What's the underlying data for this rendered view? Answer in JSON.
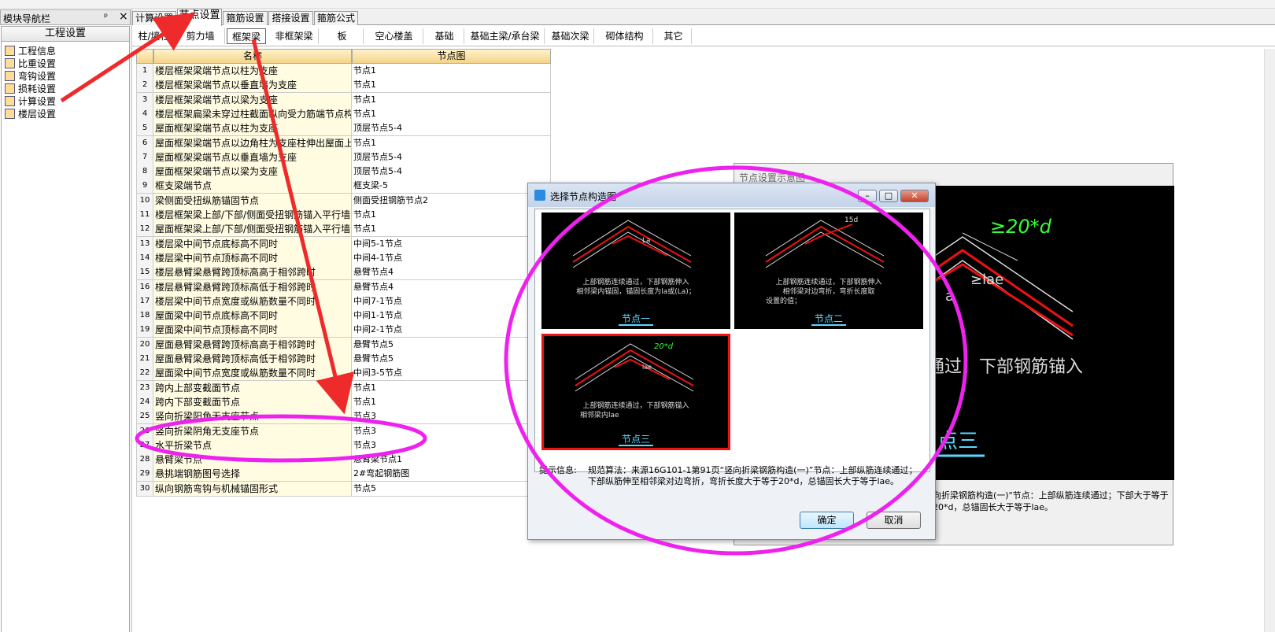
{
  "nav": {
    "title": "模块导航栏",
    "pin": "ᵖ",
    "close": "×",
    "group": "工程设置",
    "items": [
      {
        "label": "工程信息"
      },
      {
        "label": "比重设置"
      },
      {
        "label": "弯钩设置"
      },
      {
        "label": "损耗设置"
      },
      {
        "label": "计算设置"
      },
      {
        "label": "楼层设置"
      }
    ]
  },
  "tabs": [
    "计算设置",
    "节点设置",
    "箍筋设置",
    "搭接设置",
    "箍筋公式"
  ],
  "subtabs": [
    "柱/墙柱",
    "剪力墙",
    "框架梁",
    "非框架梁",
    "板",
    "空心楼盖",
    "基础",
    "基础主梁/承台梁",
    "基础次梁",
    "砌体结构",
    "其它"
  ],
  "table": {
    "headers": [
      "名称",
      "节点图"
    ],
    "rows": [
      {
        "no": "1",
        "name": "楼层框架梁端节点以柱为支座",
        "node": "节点1"
      },
      {
        "no": "2",
        "name": "楼层框架梁端节点以垂直墙为支座",
        "node": "节点1"
      },
      {
        "no": "3",
        "name": "楼层框架梁端节点以梁为支座",
        "node": "节点1"
      },
      {
        "no": "4",
        "name": "楼层框架扁梁未穿过柱截面纵向受力筋端节点构",
        "node": "节点1"
      },
      {
        "no": "5",
        "name": "屋面框架梁端节点以柱为支座",
        "node": "顶层节点5-4"
      },
      {
        "no": "6",
        "name": "屋面框架梁端节点以边角柱为支座柱伸出屋面上",
        "node": "节点1"
      },
      {
        "no": "7",
        "name": "屋面框架梁端节点以垂直墙为支座",
        "node": "顶层节点5-4"
      },
      {
        "no": "8",
        "name": "屋面框架梁端节点以梁为支座",
        "node": "顶层节点5-4"
      },
      {
        "no": "9",
        "name": "框支梁端节点",
        "node": "框支梁-5"
      },
      {
        "no": "10",
        "name": "梁侧面受扭纵筋锚固节点",
        "node": "侧面受扭钢筋节点2"
      },
      {
        "no": "11",
        "name": "楼层框架梁上部/下部/侧面受扭钢筋锚入平行墙",
        "node": "节点1"
      },
      {
        "no": "12",
        "name": "屋面框架梁上部/下部/侧面受扭钢筋锚入平行墙",
        "node": "节点1"
      },
      {
        "no": "13",
        "name": "楼层梁中间节点底标高不同时",
        "node": "中间5-1节点"
      },
      {
        "no": "14",
        "name": "楼层梁中间节点顶标高不同时",
        "node": "中间4-1节点"
      },
      {
        "no": "15",
        "name": "楼层悬臂梁悬臂跨顶标高高于相邻跨时",
        "node": "悬臂节点4"
      },
      {
        "no": "16",
        "name": "楼层悬臂梁悬臂跨顶标高低于相邻跨时",
        "node": "悬臂节点4"
      },
      {
        "no": "17",
        "name": "楼层梁中间节点宽度或纵筋数量不同时",
        "node": "中间7-1节点"
      },
      {
        "no": "18",
        "name": "屋面梁中间节点底标高不同时",
        "node": "中间1-1节点"
      },
      {
        "no": "19",
        "name": "屋面梁中间节点顶标高不同时",
        "node": "中间2-1节点"
      },
      {
        "no": "20",
        "name": "屋面悬臂梁悬臂跨顶标高高于相邻跨时",
        "node": "悬臂节点5"
      },
      {
        "no": "21",
        "name": "屋面悬臂梁悬臂跨顶标高低于相邻跨时",
        "node": "悬臂节点5"
      },
      {
        "no": "22",
        "name": "屋面梁中间节点宽度或纵筋数量不同时",
        "node": "中间3-5节点"
      },
      {
        "no": "23",
        "name": "跨内上部变截面节点",
        "node": "节点1"
      },
      {
        "no": "24",
        "name": "跨内下部变截面节点",
        "node": "节点1"
      },
      {
        "no": "25",
        "name": "竖向折梁阳角无支座节点",
        "node": "节点3"
      },
      {
        "no": "26",
        "name": "竖向折梁阴角无支座节点",
        "node": "节点3"
      },
      {
        "no": "27",
        "name": "水平折梁节点",
        "node": "节点3"
      },
      {
        "no": "28",
        "name": "悬臂梁节点",
        "node": "悬臂梁节点1"
      },
      {
        "no": "29",
        "name": "悬挑端钢筋图号选择",
        "node": "2#弯起钢筋图"
      },
      {
        "no": "30",
        "name": "纵向钢筋弯钩与机械锚固形式",
        "node": "节点5"
      }
    ]
  },
  "preview": {
    "title": "节点设置示意图",
    "label20d": "≥20*d",
    "label_lae": "≥lae",
    "label_a": "a",
    "big_text": "通过，下部钢筋锚入",
    "node_label": "点三",
    "info": "向折梁钢筋构造(一)\"节点：上部纵筋连续通过；下部大于等于20*d，总锚固长大于等于lae。"
  },
  "dialog": {
    "title": "选择节点构造图",
    "min": "–",
    "max": "□",
    "close": "✕",
    "thumbs": [
      {
        "caption": "节点一",
        "desc1": "上部钢筋连续通过，下部钢筋伸入",
        "desc2": "相邻梁内锚固，锚固长度为la或(La)；",
        "tag": "La"
      },
      {
        "caption": "节点二",
        "desc1": "上部钢筋连续通过，下部钢筋伸入",
        "desc2": "相邻梁对边弯折，弯折长度取",
        "desc3": "设置的值；",
        "tag": "15d"
      },
      {
        "caption": "节点三",
        "desc1": "上部钢筋连续通过，下部钢筋锚入",
        "desc2": "相邻梁内lae",
        "tag": "20*d",
        "tag2": "lae"
      }
    ],
    "hint_label": "提示信息:",
    "hint_text": "规范算法：来源16G101-1第91页“竖向折梁钢筋构造(一)”节点：上部纵筋连续通过；下部纵筋伸至相邻梁对边弯折，弯折长度大于等于20*d，总锚固长大于等于lae。",
    "ok": "确定",
    "cancel": "取消"
  },
  "colors": {
    "annotation_magenta": "#ee22ee",
    "arrow_red": "#ee2a2a",
    "header_gold": "#f5d48a",
    "name_cell": "#fffce2"
  }
}
